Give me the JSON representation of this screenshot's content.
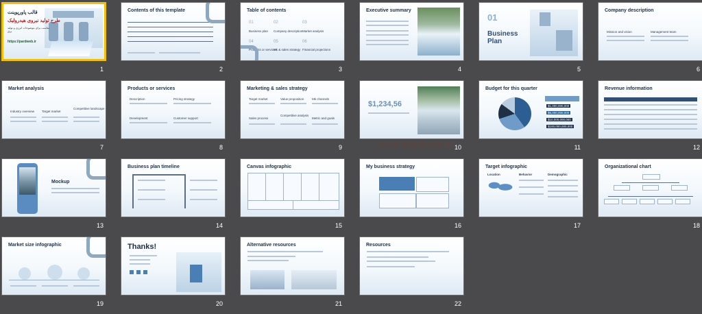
{
  "slides": [
    {
      "num": "1",
      "title": "",
      "selected": true,
      "fa": {
        "template": "قالب پاورپوینت",
        "topic": "طرح تولید نیروی هیدرولیک",
        "subtitle": "مناسب برای موضوعات انرژی و تولید برق",
        "url": "https://pardweb.ir"
      }
    },
    {
      "num": "2",
      "title": "Contents of this template"
    },
    {
      "num": "3",
      "title": "Table of contents",
      "toc": [
        "01",
        "02",
        "03",
        "04",
        "05",
        "06"
      ],
      "toc_labels": [
        "Business plan",
        "Company description",
        "Market analysis",
        "Products or services",
        "Mk & sales strategy",
        "Financial projections"
      ]
    },
    {
      "num": "4",
      "title": "Executive summary"
    },
    {
      "num": "5",
      "title": "",
      "section_num": "01",
      "section_title": "Business Plan"
    },
    {
      "num": "6",
      "title": "Company description",
      "sub": [
        "Mission and vision",
        "Management team"
      ]
    },
    {
      "num": "7",
      "title": "Market analysis",
      "sub": [
        "Industry overview",
        "Target market",
        "Competitive landscape"
      ]
    },
    {
      "num": "8",
      "title": "Products or services",
      "sub": [
        "Description",
        "Pricing strategy",
        "Development",
        "Customer support"
      ]
    },
    {
      "num": "9",
      "title": "Marketing & sales strategy",
      "sub": [
        "Target market",
        "Value proposition",
        "Mk channels",
        "Sales process",
        "Competitive analysis",
        "Metric and goals"
      ]
    },
    {
      "num": "10",
      "title": "",
      "amount": "$1,234,56"
    },
    {
      "num": "11",
      "title": "Budget for this quarter",
      "budget": [
        "$1,000,000,000",
        "$5,000,000,000",
        "$10,000,000,000",
        "$100,000,000,000"
      ]
    },
    {
      "num": "12",
      "title": "Revenue information"
    },
    {
      "num": "13",
      "title": "Mockup"
    },
    {
      "num": "14",
      "title": "Business plan timeline"
    },
    {
      "num": "15",
      "title": "Canvas infographic"
    },
    {
      "num": "16",
      "title": "My business strategy"
    },
    {
      "num": "17",
      "title": "Target infographic",
      "sub": [
        "Location",
        "Behavior",
        "Demographic"
      ]
    },
    {
      "num": "18",
      "title": "Organizational chart"
    },
    {
      "num": "19",
      "title": "Market size infographic"
    },
    {
      "num": "20",
      "title": "Thanks!"
    },
    {
      "num": "21",
      "title": "Alternative resources"
    },
    {
      "num": "22",
      "title": "Resources"
    }
  ],
  "watermark": "www.Pardweb.ir",
  "colors": {
    "background": "#4a4a4d",
    "selected_border": "#f2c200",
    "accent": "#4a7fb6"
  }
}
